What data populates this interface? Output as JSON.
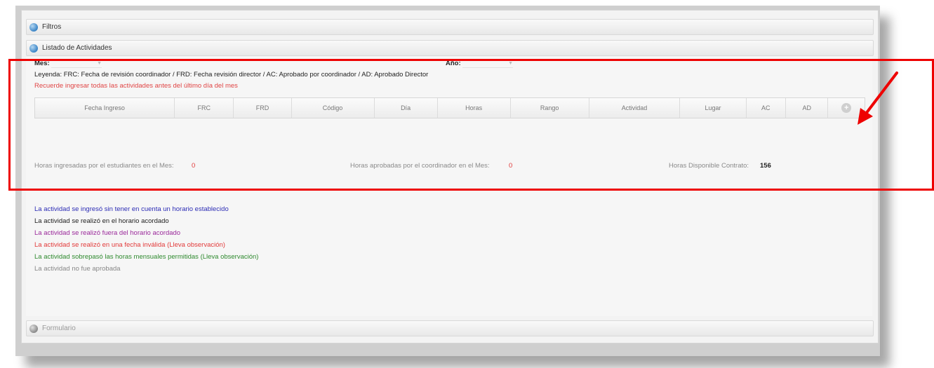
{
  "accordion": {
    "filtros": "Filtros",
    "listado": "Listado de Actividades",
    "formulario": "Formulario"
  },
  "filters": {
    "mes_label": "Mes:",
    "mes_value": "",
    "anio_label": "Año:",
    "anio_value": ""
  },
  "legend": "Leyenda: FRC: Fecha de revisión coordinador / FRD: Fecha revisión director / AC: Aprobado por coordinador / AD: Aprobado Director",
  "reminder": "Recuerde ingresar todas las actividades antes del último día del mes",
  "table": {
    "columns": [
      "Fecha Ingreso",
      "FRC",
      "FRD",
      "Código",
      "Día",
      "Horas",
      "Rango",
      "Actividad",
      "Lugar",
      "AC",
      "AD"
    ],
    "add_button": "+"
  },
  "summary": {
    "horas_ingresadas_label": "Horas ingresadas por el estudiantes en el Mes:",
    "horas_ingresadas_value": "0",
    "horas_aprobadas_label": "Horas aprobadas por el coordinador en el Mes:",
    "horas_aprobadas_value": "0",
    "horas_disponible_label": "Horas Disponible Contrato:",
    "horas_disponible_value": "156"
  },
  "color_legend": [
    {
      "text": "La actividad se ingresó sin tener en cuenta un horario establecido",
      "color": "#2d2db5"
    },
    {
      "text": "La actividad se realizó en el horario acordado",
      "color": "#222222"
    },
    {
      "text": "La actividad se realizó fuera del horario acordado",
      "color": "#9b2a9b"
    },
    {
      "text": "La actividad se realizó en una fecha inválida (Lleva observación)",
      "color": "#e23a3a"
    },
    {
      "text": "La actividad sobrepasó las horas mensuales permitidas (Lleva observación)",
      "color": "#2f8a2f"
    },
    {
      "text": "La actividad no fue aprobada",
      "color": "#888888"
    }
  ],
  "annotation_colors": {
    "highlight_box": "#ee0000",
    "arrow": "#ee0000"
  }
}
